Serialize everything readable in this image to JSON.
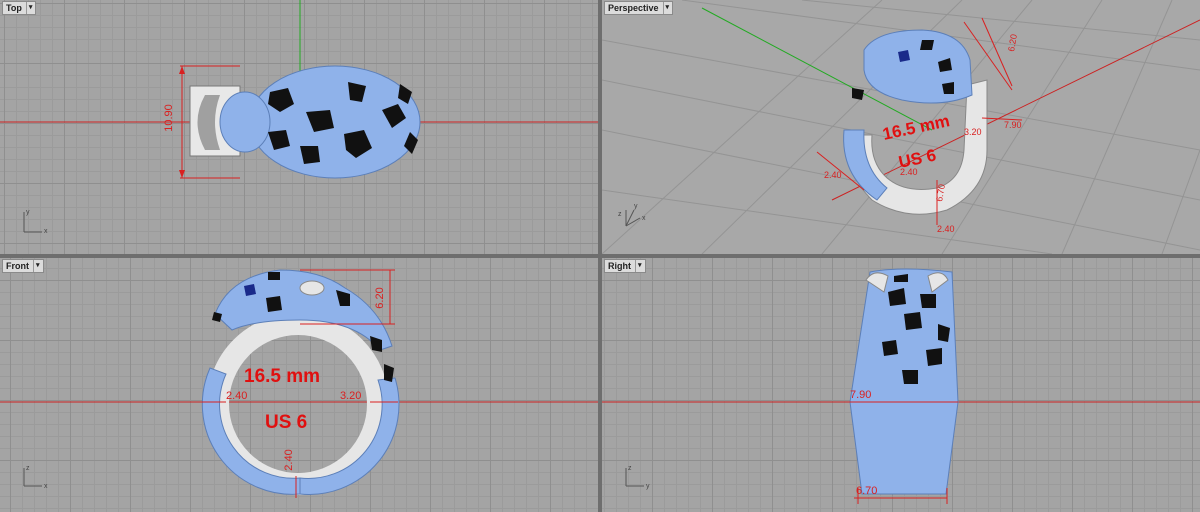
{
  "viewports": {
    "top": {
      "title": "Top"
    },
    "perspective": {
      "title": "Perspective"
    },
    "front": {
      "title": "Front"
    },
    "right": {
      "title": "Right"
    }
  },
  "dropdown_glyph": "▾",
  "axis": {
    "x": "x",
    "y": "y",
    "z": "z"
  },
  "dimensions": {
    "top": {
      "height": "10.90"
    },
    "perspective": {
      "d1": "6.20",
      "d2": "7.90",
      "d3": "2.40",
      "d4": "3.20",
      "d5": "2.40",
      "d6": "6.70",
      "d7": "2.40"
    },
    "front": {
      "top": "6.20",
      "left": "2.40",
      "right": "3.20",
      "bottom": "2.40"
    },
    "right": {
      "top": "7.90",
      "bottom": "6.70"
    }
  },
  "labels": {
    "size_mm": "16.5 mm",
    "size_us": "US 6"
  },
  "colors": {
    "gem": "#8fb2ea",
    "metal": "#e6e6e6",
    "spot": "#111111",
    "dim": "#d92020",
    "axis_red": "#cc2222",
    "axis_green": "#22aa22"
  }
}
